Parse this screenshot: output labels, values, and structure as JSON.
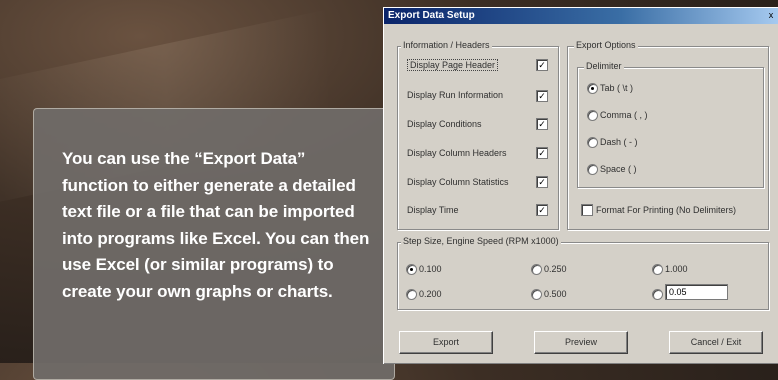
{
  "callout": {
    "text": "You can use the “Export Data” function to either generate a detailed text file or a file that can be imported into programs like Excel. You can then use Excel (or similar programs) to create your own graphs or charts."
  },
  "dialog": {
    "title": "Export Data Setup",
    "close_label": "x",
    "info_group": {
      "label": "Information / Headers",
      "items": [
        {
          "label": "Display Page Header",
          "checked": true
        },
        {
          "label": "Display Run Information",
          "checked": true
        },
        {
          "label": "Display Conditions",
          "checked": true
        },
        {
          "label": "Display Column Headers",
          "checked": true
        },
        {
          "label": "Display Column Statistics",
          "checked": true
        },
        {
          "label": "Display Time",
          "checked": true
        }
      ],
      "check_mark": "✓"
    },
    "export_options": {
      "label": "Export Options",
      "delimiter": {
        "label": "Delimiter",
        "options": [
          {
            "label": "Tab ( \\t )",
            "selected": true
          },
          {
            "label": "Comma ( , )",
            "selected": false
          },
          {
            "label": "Dash ( - )",
            "selected": false
          },
          {
            "label": "Space ( )",
            "selected": false
          }
        ]
      },
      "format_printing_label": "Format For Printing (No Delimiters)"
    },
    "step_size": {
      "label": "Step Size, Engine Speed (RPM x1000)",
      "options": [
        {
          "label": "0.100",
          "selected": true
        },
        {
          "label": "0.250",
          "selected": false
        },
        {
          "label": "1.000",
          "selected": false
        },
        {
          "label": "0.200",
          "selected": false
        },
        {
          "label": "0.500",
          "selected": false
        }
      ],
      "custom_value": "0.05"
    },
    "buttons": {
      "export": "Export",
      "preview": "Preview",
      "cancel": "Cancel / Exit"
    }
  }
}
